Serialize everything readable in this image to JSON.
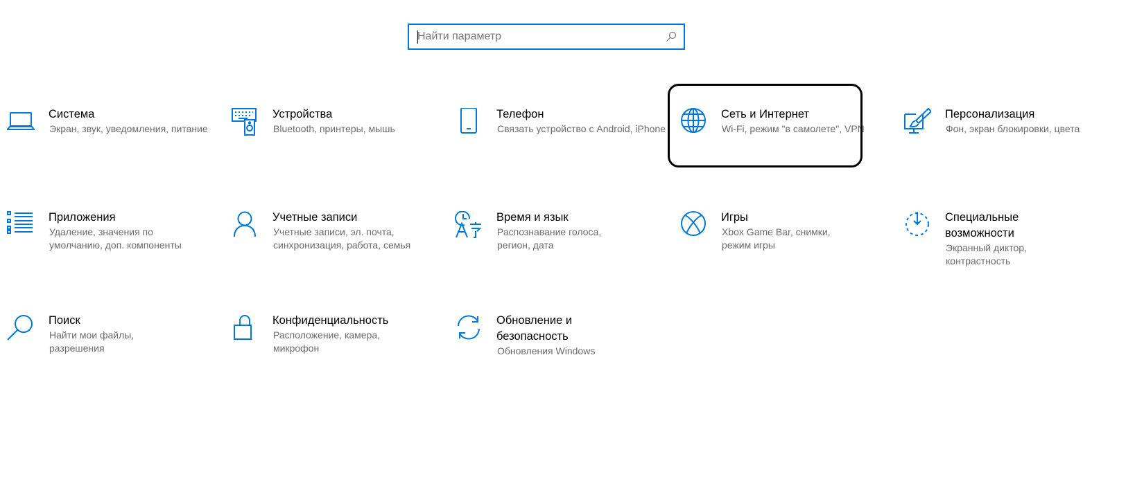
{
  "search": {
    "placeholder": "Найти параметр",
    "value": ""
  },
  "tiles": [
    {
      "title": "Система",
      "desc": "Экран, звук, уведомления, питание",
      "icon": "laptop-icon"
    },
    {
      "title": "Устройства",
      "desc": "Bluetooth, принтеры, мышь",
      "icon": "devices-icon"
    },
    {
      "title": "Телефон",
      "desc": "Связать устройство с Android, iPhone",
      "icon": "phone-icon"
    },
    {
      "title": "Сеть и Интернет",
      "desc": "Wi-Fi, режим \"в самолете\", VPN",
      "icon": "globe-icon"
    },
    {
      "title": "Персонализация",
      "desc": "Фон, экран блокировки, цвета",
      "icon": "personalization-icon"
    },
    {
      "title": "Приложения",
      "desc": "Удаление, значения по умолчанию, доп. компоненты",
      "icon": "apps-list-icon"
    },
    {
      "title": "Учетные записи",
      "desc": "Учетные записи, эл. почта, синхронизация, работа, семья",
      "icon": "person-icon"
    },
    {
      "title": "Время и язык",
      "desc": "Распознавание голоса, регион, дата",
      "icon": "time-language-icon"
    },
    {
      "title": "Игры",
      "desc": "Xbox Game Bar, снимки, режим игры",
      "icon": "xbox-icon"
    },
    {
      "title": "Специальные возможности",
      "desc": "Экранный диктор, контрастность",
      "icon": "accessibility-icon"
    },
    {
      "title": "Поиск",
      "desc": "Найти мои файлы, разрешения",
      "icon": "search-icon"
    },
    {
      "title": "Конфиденциальность",
      "desc": "Расположение, камера, микрофон",
      "icon": "lock-icon"
    },
    {
      "title": "Обновление и безопасность",
      "desc": "Обновления Windows",
      "icon": "sync-icon"
    }
  ],
  "accent_color": "#0078d7"
}
